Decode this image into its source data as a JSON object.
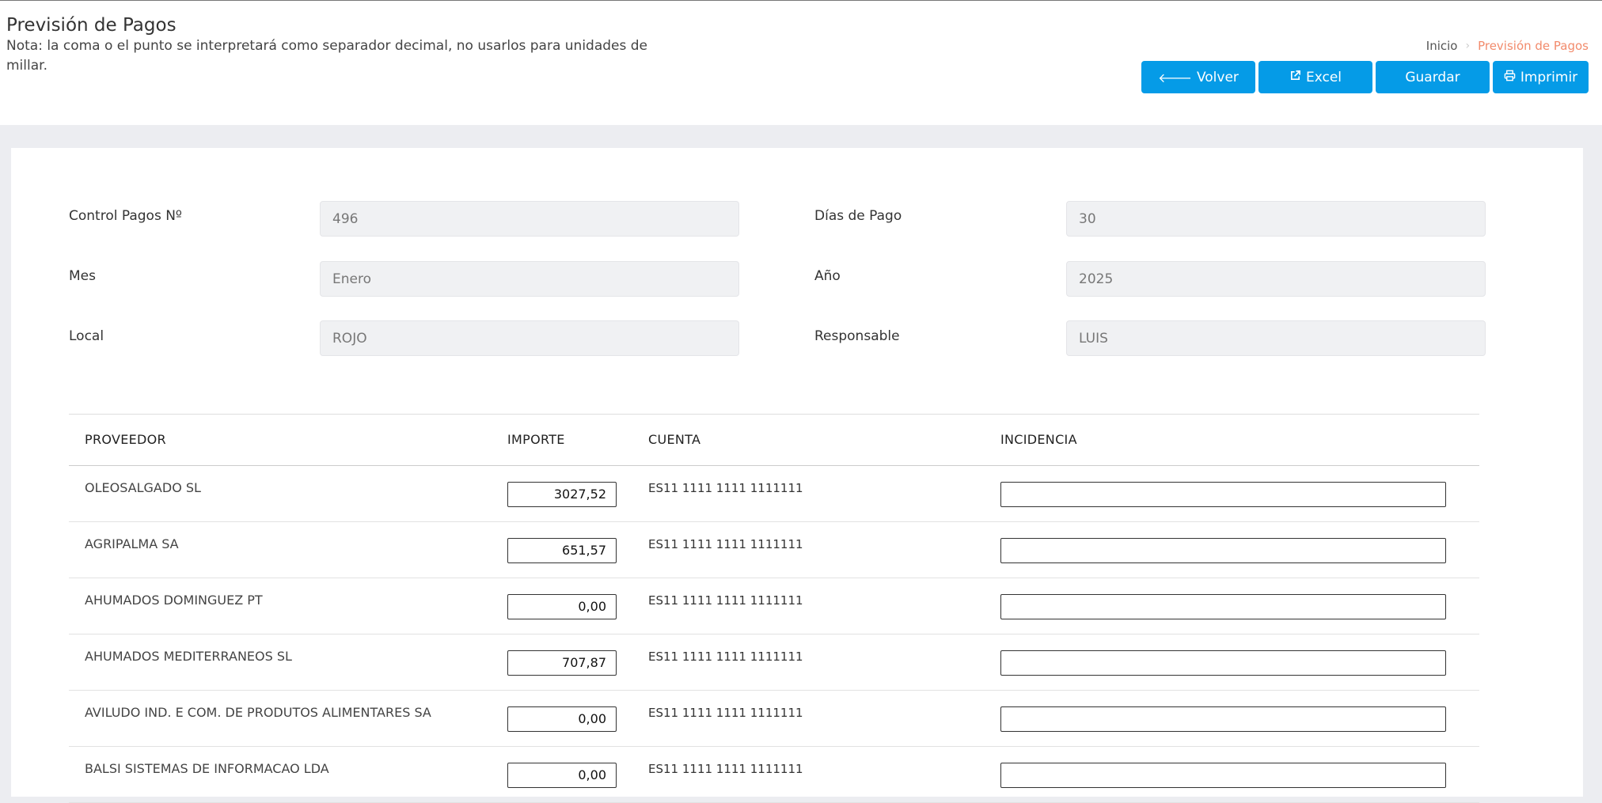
{
  "header": {
    "title": "Previsión de Pagos",
    "note": "Nota: la coma o el punto se interpretará como separador decimal, no usarlos para unidades de millar."
  },
  "breadcrumb": {
    "home": "Inicio",
    "separator": "›",
    "current": "Previsión de Pagos"
  },
  "toolbar": {
    "volver": "Volver",
    "excel": "Excel",
    "guardar": "Guardar",
    "imprimir": "Imprimir"
  },
  "form": {
    "control_label": "Control Pagos Nº",
    "control_value": "496",
    "dias_label": "Días de Pago",
    "dias_value": "30",
    "mes_label": "Mes",
    "mes_value": "Enero",
    "anio_label": "Año",
    "anio_value": "2025",
    "local_label": "Local",
    "local_value": "ROJO",
    "responsable_label": "Responsable",
    "responsable_value": "LUIS"
  },
  "table": {
    "headers": {
      "proveedor": "PROVEEDOR",
      "importe": "IMPORTE",
      "cuenta": "CUENTA",
      "incidencia": "INCIDENCIA"
    },
    "rows": [
      {
        "proveedor": "OLEOSALGADO SL",
        "importe": "3027,52",
        "cuenta": "ES11 1111 1111 1111111",
        "incidencia": ""
      },
      {
        "proveedor": "AGRIPALMA SA",
        "importe": "651,57",
        "cuenta": "ES11 1111 1111 1111111",
        "incidencia": ""
      },
      {
        "proveedor": "AHUMADOS DOMINGUEZ PT",
        "importe": "0,00",
        "cuenta": "ES11 1111 1111 1111111",
        "incidencia": ""
      },
      {
        "proveedor": "AHUMADOS MEDITERRANEOS SL",
        "importe": "707,87",
        "cuenta": "ES11 1111 1111 1111111",
        "incidencia": ""
      },
      {
        "proveedor": "AVILUDO IND. E COM. DE PRODUTOS ALIMENTARES SA",
        "importe": "0,00",
        "cuenta": "ES11 1111 1111 1111111",
        "incidencia": ""
      },
      {
        "proveedor": "BALSI SISTEMAS DE INFORMACAO LDA",
        "importe": "0,00",
        "cuenta": "ES11 1111 1111 1111111",
        "incidencia": ""
      }
    ]
  },
  "colors": {
    "primary": "#059be7",
    "breadcrumb_active": "#f28b6c",
    "page_bg": "#ecedf1"
  }
}
